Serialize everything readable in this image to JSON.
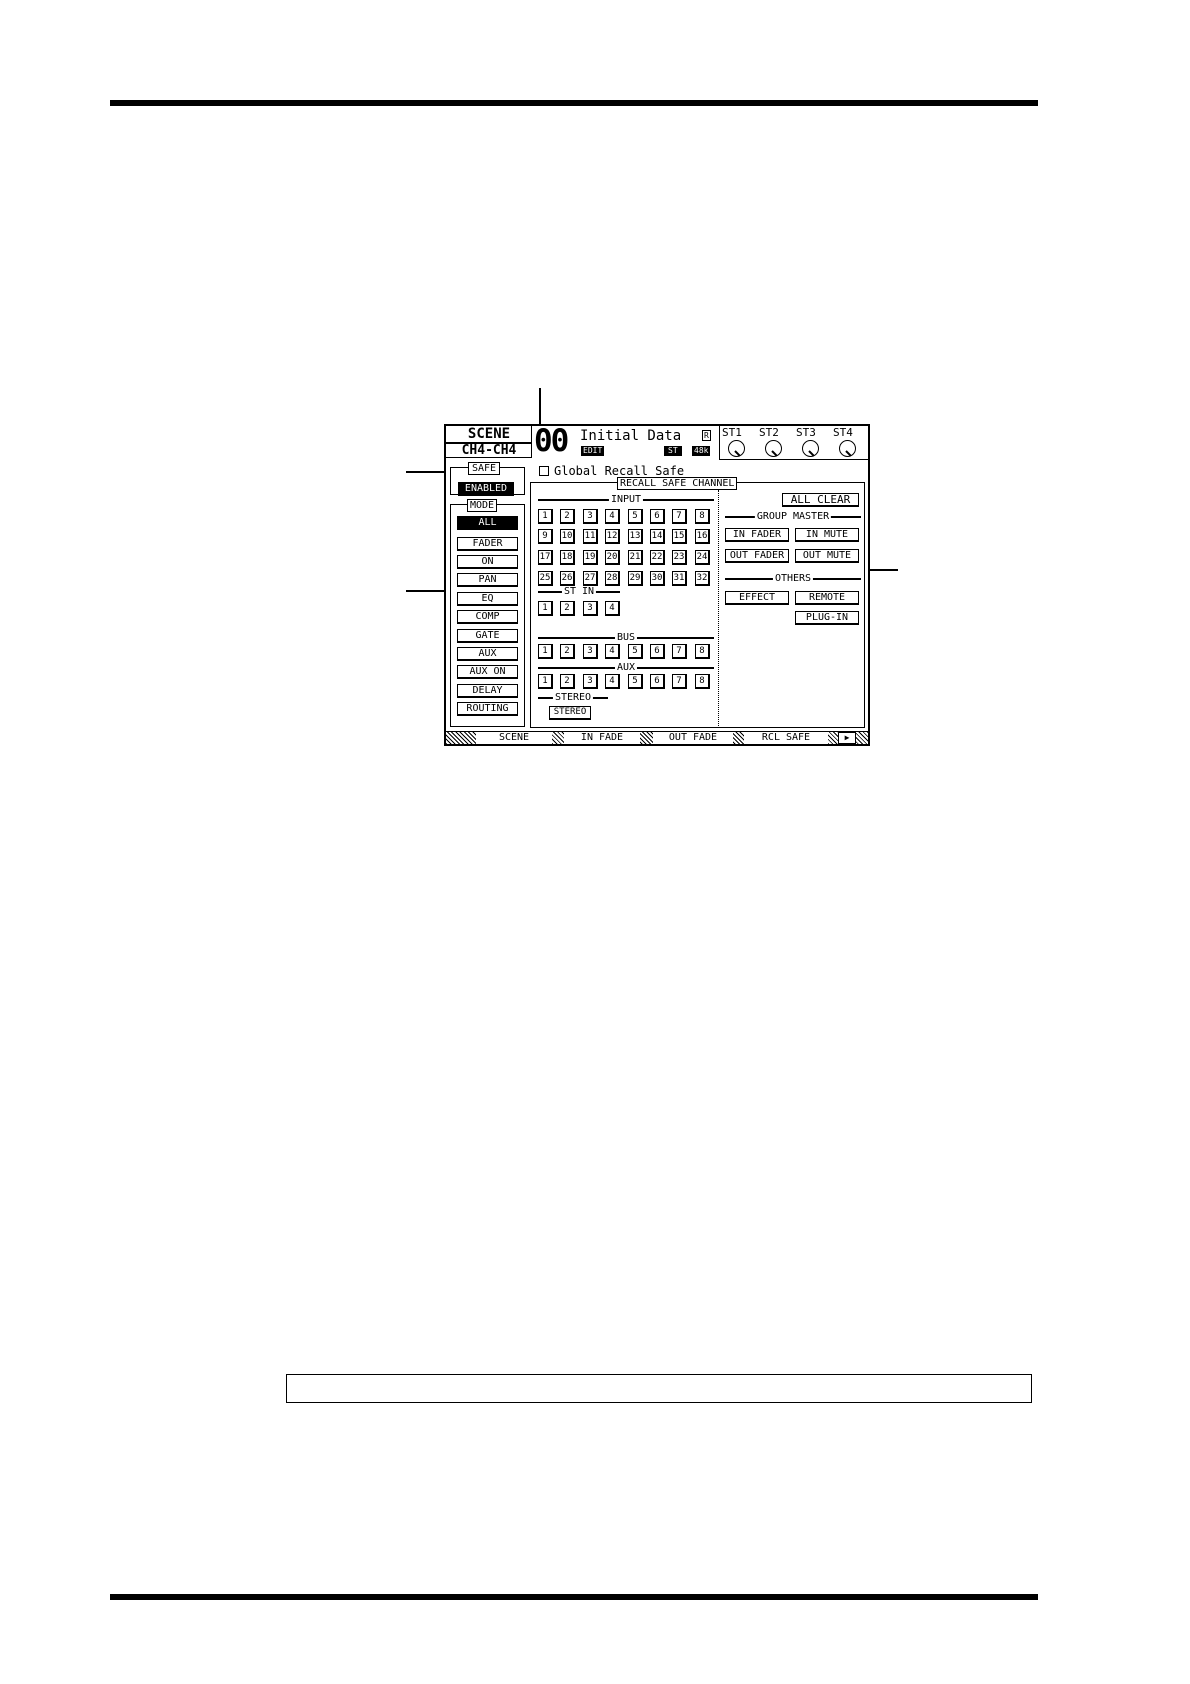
{
  "header": {
    "scene_label": "SCENE",
    "channel_range": "CH4-CH4",
    "scene_number": "00",
    "scene_title": "Initial Data",
    "edit_badge": "EDIT",
    "r_badge": "R",
    "st_badge": "ST",
    "rate_badge": "48k",
    "st_knobs": [
      {
        "label": "ST1"
      },
      {
        "label": "ST2"
      },
      {
        "label": "ST3"
      },
      {
        "label": "ST4"
      }
    ]
  },
  "global_recall_safe": {
    "label": "Global Recall Safe",
    "checked": false
  },
  "safe_panel": {
    "label": "SAFE",
    "enabled_label": "ENABLED",
    "mode_label": "MODE",
    "mode_buttons": [
      {
        "label": "ALL",
        "selected": true
      },
      {
        "label": "FADER",
        "selected": false
      },
      {
        "label": "ON",
        "selected": false
      },
      {
        "label": "PAN",
        "selected": false
      },
      {
        "label": "EQ",
        "selected": false
      },
      {
        "label": "COMP",
        "selected": false
      },
      {
        "label": "GATE",
        "selected": false
      },
      {
        "label": "AUX",
        "selected": false
      },
      {
        "label": "AUX ON",
        "selected": false
      },
      {
        "label": "DELAY",
        "selected": false
      },
      {
        "label": "ROUTING",
        "selected": false
      }
    ]
  },
  "channel_panel": {
    "title": "RECALL SAFE CHANNEL",
    "all_clear_label": "ALL CLEAR",
    "input": {
      "label": "INPUT",
      "channels": [
        "1",
        "2",
        "3",
        "4",
        "5",
        "6",
        "7",
        "8",
        "9",
        "10",
        "11",
        "12",
        "13",
        "14",
        "15",
        "16",
        "17",
        "18",
        "19",
        "20",
        "21",
        "22",
        "23",
        "24",
        "25",
        "26",
        "27",
        "28",
        "29",
        "30",
        "31",
        "32"
      ]
    },
    "st_in": {
      "label": "ST IN",
      "channels": [
        "1",
        "2",
        "3",
        "4"
      ]
    },
    "bus": {
      "label": "BUS",
      "channels": [
        "1",
        "2",
        "3",
        "4",
        "5",
        "6",
        "7",
        "8"
      ]
    },
    "aux": {
      "label": "AUX",
      "channels": [
        "1",
        "2",
        "3",
        "4",
        "5",
        "6",
        "7",
        "8"
      ]
    },
    "stereo": {
      "label": "STEREO",
      "button": "STEREO"
    },
    "group_master": {
      "label": "GROUP MASTER",
      "buttons": [
        "IN FADER",
        "IN MUTE",
        "OUT FADER",
        "OUT MUTE"
      ]
    },
    "others": {
      "label": "OTHERS",
      "buttons": [
        "EFFECT",
        "REMOTE",
        "PLUG-IN"
      ]
    }
  },
  "tabs": [
    {
      "label": "SCENE"
    },
    {
      "label": "IN FADE"
    },
    {
      "label": "OUT FADE"
    },
    {
      "label": "RCL SAFE",
      "active": true
    },
    {
      "label": "▶"
    }
  ]
}
